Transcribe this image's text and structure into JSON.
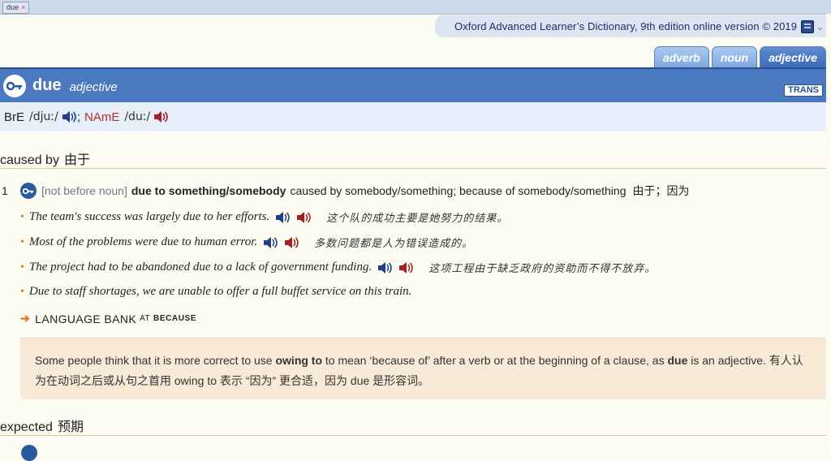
{
  "browser_tab": {
    "label": "due",
    "close": "×"
  },
  "source": {
    "text": "Oxford Advanced Learner’s Dictionary, 9th edition online version © 2019"
  },
  "pos_tabs": [
    {
      "label": "adverb",
      "active": false
    },
    {
      "label": "noun",
      "active": false
    },
    {
      "label": "adjective",
      "active": true
    }
  ],
  "entry": {
    "headword": "due",
    "pos": "adjective",
    "trans_button": "TRANS",
    "pron": {
      "bre_label": "BrE",
      "bre_ipa": "/djuː/",
      "sep": ";",
      "name_label": "NAmE",
      "name_ipa": "/duː/"
    }
  },
  "senses": [
    {
      "shortcut": "caused by",
      "shortcut_zh": "由于",
      "number": "1",
      "grammar": "[not before noun]",
      "cf": "due to something/somebody",
      "definition": "caused by somebody/something; because of somebody/something",
      "definition_zh": "由于；因为",
      "examples": [
        {
          "en": "The team's success was largely due to her efforts.",
          "zh": "这个队的成功主要是她努力的结果。"
        },
        {
          "en": "Most of the problems were due to human error.",
          "zh": "多数问题都是人为错误造成的。"
        },
        {
          "en": "The project had to be abandoned due to a lack of government funding.",
          "zh": "这项工程由于缺乏政府的资助而不得不放弃。"
        },
        {
          "en": "Due to staff shortages, we are unable to offer a full buffet service on this train.",
          "zh": ""
        }
      ],
      "language_bank": {
        "label": "LANGUAGE BANK",
        "at": "AT",
        "target": "BECAUSE"
      },
      "note": {
        "part1": "Some people think that it is more correct to use ",
        "bold1": "owing to",
        "part2": " to mean ‘because of’ after a verb or at the beginning of a clause, as ",
        "bold2": "due",
        "part3": " is an adjective. ",
        "zh": " 有人认为在动词之后或从句之首用 owing to 表示 “因为” 更合适，因为 due 是形容词。"
      }
    },
    {
      "shortcut": "expected",
      "shortcut_zh": "预期"
    }
  ],
  "colors": {
    "header_blue": "#4a79c0",
    "bullet_orange": "#e07a20",
    "name_red": "#b03030",
    "note_bg": "#f8ead7"
  },
  "icons": [
    "key-icon",
    "speaker-blue-icon",
    "speaker-red-icon",
    "book-icon",
    "chevron-down-icon",
    "arrow-right-icon"
  ]
}
